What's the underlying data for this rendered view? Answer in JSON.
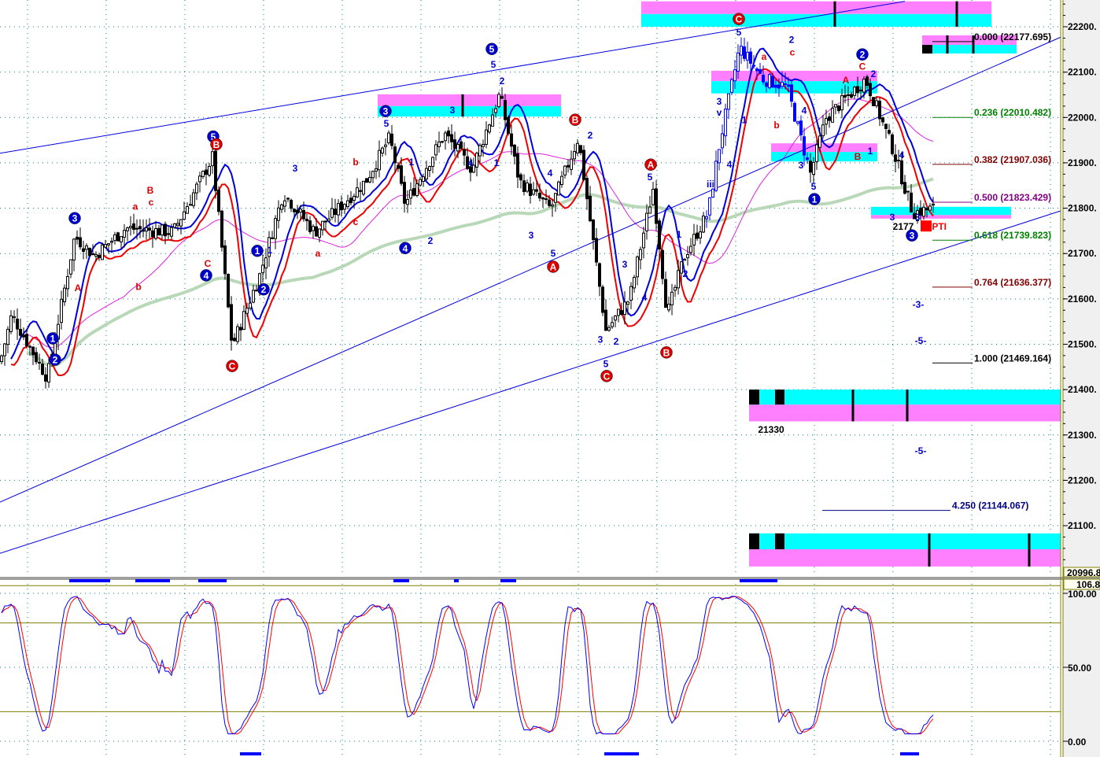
{
  "chart_data": [
    {
      "type": "candlestick",
      "title": "",
      "y_axis": {
        "ylim": [
          20996.8,
          22260
        ],
        "tick_labels": [
          "22200.",
          "22100.",
          "22000.",
          "21900.",
          "21800.",
          "21700.",
          "21600.",
          "21500.",
          "21400.",
          "21300.",
          "21200.",
          "21100."
        ],
        "ticks": [
          22200,
          22100,
          22000,
          21900,
          21800,
          21700,
          21600,
          21500,
          21400,
          21300,
          21200,
          21100
        ],
        "min_label": "20996.8"
      },
      "grid": true,
      "price_path": [
        [
          0,
          21461
        ],
        [
          3.75,
          21565
        ],
        [
          15,
          21426
        ],
        [
          23.75,
          21738
        ],
        [
          30,
          21695
        ],
        [
          40,
          21756
        ],
        [
          55,
          21747
        ],
        [
          67.5,
          21912
        ],
        [
          73.75,
          21496
        ],
        [
          82.5,
          21652
        ],
        [
          90,
          21834
        ],
        [
          100,
          21747
        ],
        [
          116.25,
          21860
        ],
        [
          123.75,
          21955
        ],
        [
          128.75,
          21808
        ],
        [
          141.25,
          21964
        ],
        [
          150,
          21886
        ],
        [
          158.75,
          22051
        ],
        [
          165,
          21860
        ],
        [
          175,
          21799
        ],
        [
          183.75,
          21955
        ],
        [
          192.5,
          21530
        ],
        [
          200,
          21600
        ],
        [
          207.5,
          21843
        ],
        [
          212,
          21565
        ],
        [
          217.5,
          21695
        ],
        [
          225,
          21790
        ],
        [
          228.75,
          21946
        ],
        [
          235,
          22155
        ],
        [
          242.5,
          22085
        ],
        [
          250,
          22068
        ],
        [
          257.5,
          21877
        ],
        [
          262.5,
          21999
        ],
        [
          275,
          22085
        ],
        [
          283.75,
          21929
        ],
        [
          290,
          21790
        ],
        [
          296,
          21799
        ]
      ],
      "fib_levels": [
        {
          "ratio": "0.000",
          "value": "(22177.695)",
          "price": 22177.695,
          "color": "#000000"
        },
        {
          "ratio": "0.236",
          "value": "(22010.482)",
          "price": 22010.482,
          "color": "#008000"
        },
        {
          "ratio": "0.382",
          "value": "(21907.036)",
          "price": 21907.036,
          "color": "#800000"
        },
        {
          "ratio": "0.500",
          "value": "(21823.429)",
          "price": 21823.429,
          "color": "#800080"
        },
        {
          "ratio": "0.618",
          "value": "(21739.823)",
          "price": 21739.823,
          "color": "#008000"
        },
        {
          "ratio": "0.764",
          "value": "(21636.377)",
          "price": 21636.377,
          "color": "#800000"
        },
        {
          "ratio": "1.000",
          "value": "(21469.164)",
          "price": 21469.164,
          "color": "#000000"
        },
        {
          "ratio": "4.250",
          "value": "(21144.067)",
          "price": 21144.067,
          "color": "#000080",
          "long": true
        }
      ],
      "trend_lines": [
        {
          "from": [
            0,
            21921
          ],
          "to": [
            287.5,
            22256
          ]
        },
        {
          "from": [
            0,
            21152
          ],
          "to": [
            337,
            22177
          ]
        },
        {
          "from": [
            0,
            21039
          ],
          "to": [
            337,
            21794
          ]
        }
      ],
      "zones": [
        {
          "bars": [
            203.75,
            315
          ],
          "magenta": [
            22256,
            22228
          ],
          "cyan": [
            22228,
            22200
          ],
          "ticks": [
            265.25,
            304
          ]
        },
        {
          "bars": [
            293,
            323
          ],
          "magenta": [
            22181,
            22160
          ],
          "cyan": [
            22160,
            22141
          ],
          "ticks": [
            301,
            309.25
          ],
          "block": [
            293,
            296.25
          ]
        },
        {
          "bars": [
            120,
            178.25
          ],
          "magenta": [
            22051,
            22025
          ],
          "cyan": [
            22025,
            22002
          ],
          "ticks": [
            147
          ]
        },
        {
          "bars": [
            226,
            278.75
          ],
          "magenta": [
            22103,
            22080
          ],
          "cyan": [
            22080,
            22053
          ],
          "ticks": []
        },
        {
          "bars": [
            245,
            278.75
          ],
          "magenta": [
            21943,
            21924
          ],
          "cyan": [
            21924,
            21903
          ],
          "ticks": []
        },
        {
          "bars": [
            276.75,
            321.25
          ],
          "magenta": [
            21785,
            21777
          ],
          "cyan": [
            21803,
            21785
          ],
          "ticks": []
        },
        {
          "bars": [
            238,
            337
          ],
          "magenta": [
            21367,
            21330
          ],
          "cyan": [
            21400,
            21367
          ],
          "ticks": [
            271,
            288.25
          ],
          "block": [
            238,
            241.25
          ],
          "block2": [
            246.25,
            249.25
          ]
        },
        {
          "bars": [
            238,
            337
          ],
          "magenta": [
            21048,
            21010
          ],
          "cyan": [
            21083,
            21048
          ],
          "ticks": [
            295.25,
            327
          ],
          "block": [
            238,
            241.25
          ],
          "block2": [
            246.25,
            249.25
          ]
        }
      ],
      "wave_labels_circled": [
        {
          "t": "3",
          "bar": 23.75,
          "price": 21778,
          "color": "#0000cc"
        },
        {
          "t": "1",
          "bar": 16.75,
          "price": 21513,
          "color": "#0000cc"
        },
        {
          "t": "2",
          "bar": 17.5,
          "price": 21466,
          "color": "#0000cc"
        },
        {
          "t": "5",
          "bar": 67.75,
          "price": 21958,
          "color": "#0000cc"
        },
        {
          "t": "B",
          "bar": 68.75,
          "price": 21941,
          "color": "#dd0000"
        },
        {
          "t": "4",
          "bar": 65.5,
          "price": 21652,
          "color": "#0000cc"
        },
        {
          "t": "C",
          "bar": 73.75,
          "price": 21452,
          "color": "#dd0000"
        },
        {
          "t": "1",
          "bar": 81.75,
          "price": 21706,
          "color": "#0000cc"
        },
        {
          "t": "2",
          "bar": 83.75,
          "price": 21621,
          "color": "#0000cc"
        },
        {
          "t": "3",
          "bar": 122.5,
          "price": 22014,
          "color": "#0000cc"
        },
        {
          "t": "4",
          "bar": 128.75,
          "price": 21712,
          "color": "#0000cc"
        },
        {
          "t": "5",
          "bar": 156.25,
          "price": 22151,
          "color": "#0000cc"
        },
        {
          "t": "B",
          "bar": 182.75,
          "price": 21995,
          "color": "#dd0000"
        },
        {
          "t": "A",
          "bar": 175.75,
          "price": 21671,
          "color": "#dd0000"
        },
        {
          "t": "A",
          "bar": 206.75,
          "price": 21896,
          "color": "#dd0000"
        },
        {
          "t": "C",
          "bar": 192.75,
          "price": 21430,
          "color": "#dd0000"
        },
        {
          "t": "B",
          "bar": 211.75,
          "price": 21482,
          "color": "#dd0000"
        },
        {
          "t": "C",
          "bar": 234.75,
          "price": 22217,
          "color": "#dd0000"
        },
        {
          "t": "1",
          "bar": 258.75,
          "price": 21820,
          "color": "#0000cc"
        },
        {
          "t": "2",
          "bar": 274,
          "price": 22139,
          "color": "#0000cc"
        },
        {
          "t": "3",
          "bar": 289.75,
          "price": 21740,
          "color": "#0000cc"
        }
      ],
      "wave_labels": [
        {
          "t": "5",
          "bar": 122.75,
          "price": 21987,
          "color": "#0000cc"
        },
        {
          "t": "3",
          "bar": 143.75,
          "price": 22016,
          "color": "#0000cc"
        },
        {
          "t": "5",
          "bar": 156.75,
          "price": 22117,
          "color": "#0000cc"
        },
        {
          "t": "2",
          "bar": 159.5,
          "price": 22080,
          "color": "#0000cc"
        },
        {
          "t": "1",
          "bar": 157.75,
          "price": 21900,
          "color": "#0000cc"
        },
        {
          "t": "4",
          "bar": 149.5,
          "price": 21900,
          "color": "#0000cc"
        },
        {
          "t": "4",
          "bar": 174.75,
          "price": 21877,
          "color": "#0000cc"
        },
        {
          "t": "5",
          "bar": 175.75,
          "price": 21700,
          "color": "#0000cc"
        },
        {
          "t": "3",
          "bar": 168.75,
          "price": 21740,
          "color": "#0000cc"
        },
        {
          "t": "2",
          "bar": 136.75,
          "price": 21728,
          "color": "#0000cc"
        },
        {
          "t": "1",
          "bar": 130.75,
          "price": 21902,
          "color": "#0000cc"
        },
        {
          "t": "3",
          "bar": 93.75,
          "price": 21888,
          "color": "#0000cc"
        },
        {
          "t": "1",
          "bar": 85.75,
          "price": 21707,
          "color": "#0000cc"
        },
        {
          "t": "5",
          "bar": 206.5,
          "price": 21869,
          "color": "#0000cc"
        },
        {
          "t": "2",
          "bar": 187.5,
          "price": 21961,
          "color": "#0000cc"
        },
        {
          "t": "3",
          "bar": 190.75,
          "price": 21510,
          "color": "#0000cc"
        },
        {
          "t": "2",
          "bar": 195.75,
          "price": 21506,
          "color": "#0000cc"
        },
        {
          "t": "5",
          "bar": 192.5,
          "price": 21457,
          "color": "#0000cc"
        },
        {
          "t": "4",
          "bar": 204.75,
          "price": 21603,
          "color": "#0000cc"
        },
        {
          "t": "1",
          "bar": 215.75,
          "price": 21742,
          "color": "#0000cc"
        },
        {
          "t": "2",
          "bar": 217.75,
          "price": 21655,
          "color": "#0000cc"
        },
        {
          "t": "3",
          "bar": 198.5,
          "price": 21676,
          "color": "#0000cc"
        },
        {
          "t": "iii",
          "bar": 225.75,
          "price": 21853,
          "color": "#0000cc"
        },
        {
          "t": "3",
          "bar": 228.5,
          "price": 22035,
          "color": "#0000cc"
        },
        {
          "t": "v",
          "bar": 228.5,
          "price": 22011,
          "color": "#0000cc"
        },
        {
          "t": "4",
          "bar": 231.75,
          "price": 21896,
          "color": "#0000cc"
        },
        {
          "t": "1",
          "bar": 236.5,
          "price": 21994,
          "color": "#0000cc"
        },
        {
          "t": "5",
          "bar": 234.75,
          "price": 22188,
          "color": "#0000cc"
        },
        {
          "t": "2",
          "bar": 251.5,
          "price": 22171,
          "color": "#0000cc"
        },
        {
          "t": "4",
          "bar": 255.5,
          "price": 22015,
          "color": "#0000cc"
        },
        {
          "t": "3",
          "bar": 254.5,
          "price": 21895,
          "color": "#0000cc"
        },
        {
          "t": "5",
          "bar": 258.5,
          "price": 21848,
          "color": "#0000cc"
        },
        {
          "t": "2",
          "bar": 277.5,
          "price": 22096,
          "color": "#0000cc"
        },
        {
          "t": "1",
          "bar": 276.5,
          "price": 21926,
          "color": "#0000cc"
        },
        {
          "t": "4",
          "bar": 286.5,
          "price": 21917,
          "color": "#0000cc"
        },
        {
          "t": "3",
          "bar": 283.5,
          "price": 21780,
          "color": "#0000cc"
        },
        {
          "t": "3",
          "bar": 291.5,
          "price": 21780,
          "color": "#0000cc"
        },
        {
          "t": "-3-",
          "bar": 291.75,
          "price": 21588,
          "color": "#0000cc"
        },
        {
          "t": "-5-",
          "bar": 292.5,
          "price": 21508,
          "color": "#0000cc"
        },
        {
          "t": "-5-",
          "bar": 292.5,
          "price": 21265,
          "color": "#0000cc"
        },
        {
          "t": "A",
          "bar": 24.75,
          "price": 21624,
          "color": "#dd0000"
        },
        {
          "t": "a",
          "bar": 43,
          "price": 21804,
          "color": "#dd0000"
        },
        {
          "t": "B",
          "bar": 47.75,
          "price": 21839,
          "color": "#dd0000"
        },
        {
          "t": "c",
          "bar": 48,
          "price": 21813,
          "color": "#dd0000"
        },
        {
          "t": "b",
          "bar": 44,
          "price": 21627,
          "color": "#dd0000"
        },
        {
          "t": "C",
          "bar": 66,
          "price": 21678,
          "color": "#dd0000"
        },
        {
          "t": "b",
          "bar": 113,
          "price": 21902,
          "color": "#dd0000"
        },
        {
          "t": "c",
          "bar": 113,
          "price": 21770,
          "color": "#dd0000"
        },
        {
          "t": "a",
          "bar": 101,
          "price": 21700,
          "color": "#dd0000"
        },
        {
          "t": "a",
          "bar": 242.75,
          "price": 22134,
          "color": "#dd0000"
        },
        {
          "t": "c",
          "bar": 251.75,
          "price": 22144,
          "color": "#dd0000"
        },
        {
          "t": "b",
          "bar": 246.75,
          "price": 21983,
          "color": "#dd0000"
        },
        {
          "t": "A",
          "bar": 268.75,
          "price": 22082,
          "color": "#dd0000"
        },
        {
          "t": "C",
          "bar": 274,
          "price": 22112,
          "color": "#dd0000"
        },
        {
          "t": "B",
          "bar": 272.5,
          "price": 21914,
          "color": "#dd0000"
        },
        {
          "t": "21330",
          "bar": 245,
          "price": 21312,
          "color": "#000000"
        },
        {
          "t": "2177",
          "bar": 287,
          "price": 21759,
          "color": "#000000"
        }
      ],
      "pti_label": "57PTI",
      "series": [
        {
          "name": "fast band",
          "color": "#0000dd"
        },
        {
          "name": "slow band",
          "color": "#ee0000"
        },
        {
          "name": "ma medium",
          "color": "#dd22dd"
        },
        {
          "name": "ma long",
          "color": "#b8d8b8"
        }
      ]
    },
    {
      "type": "line",
      "title": "oscillator",
      "ylim": [
        0,
        106.8
      ],
      "top_label": "106.8",
      "tick_labels": [
        "100.00",
        "50.00",
        "0.00"
      ],
      "ticks": [
        100,
        50,
        0
      ],
      "levels": [
        80,
        20
      ],
      "series": [
        {
          "name": "%K",
          "color": "#0000ff"
        },
        {
          "name": "%D",
          "color": "#ff0000"
        }
      ]
    }
  ]
}
